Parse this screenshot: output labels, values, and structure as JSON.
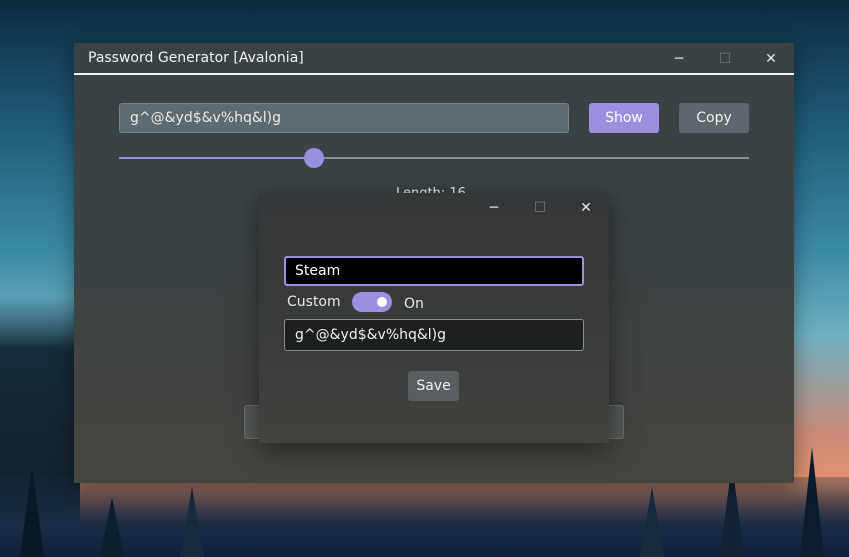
{
  "main_window": {
    "title": "Password Generator [Avalonia]",
    "password_value": "g^@&yd$&v%hq&l)g",
    "show_label": "Show",
    "copy_label": "Copy",
    "length_label": "Length: 16",
    "slider_value_fraction": 0.31
  },
  "window_controls": {
    "minimize": "─",
    "maximize": "☐",
    "close": "✕"
  },
  "dialog": {
    "name_value": "Steam",
    "custom_label": "Custom",
    "toggle_state_label": "On",
    "toggle_on": true,
    "password_value": "g^@&yd$&v%hq&l)g",
    "save_label": "Save"
  },
  "colors": {
    "accent": "#9a8fe0"
  }
}
